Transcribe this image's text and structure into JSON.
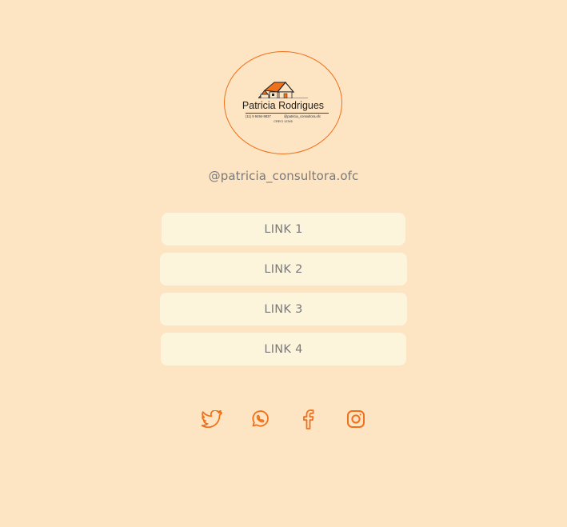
{
  "profile": {
    "logo_name": "Patricia Rodrigues",
    "logo_phone": "(11) 9 9494-9837",
    "logo_instagram": "@patricia_consultora.ofc",
    "logo_creci": "CRECI 12345",
    "handle": "@patricia_consultora.ofc"
  },
  "links": [
    {
      "label": "LINK 1"
    },
    {
      "label": "LINK 2"
    },
    {
      "label": "LINK 3"
    },
    {
      "label": "LINK 4"
    }
  ],
  "social": [
    {
      "icon": "twitter-icon"
    },
    {
      "icon": "whatsapp-icon"
    },
    {
      "icon": "facebook-icon"
    },
    {
      "icon": "instagram-icon"
    }
  ],
  "colors": {
    "background": "#fde4c3",
    "button": "#fdf4dc",
    "accent": "#f0711c",
    "text": "#7a7a7a"
  }
}
